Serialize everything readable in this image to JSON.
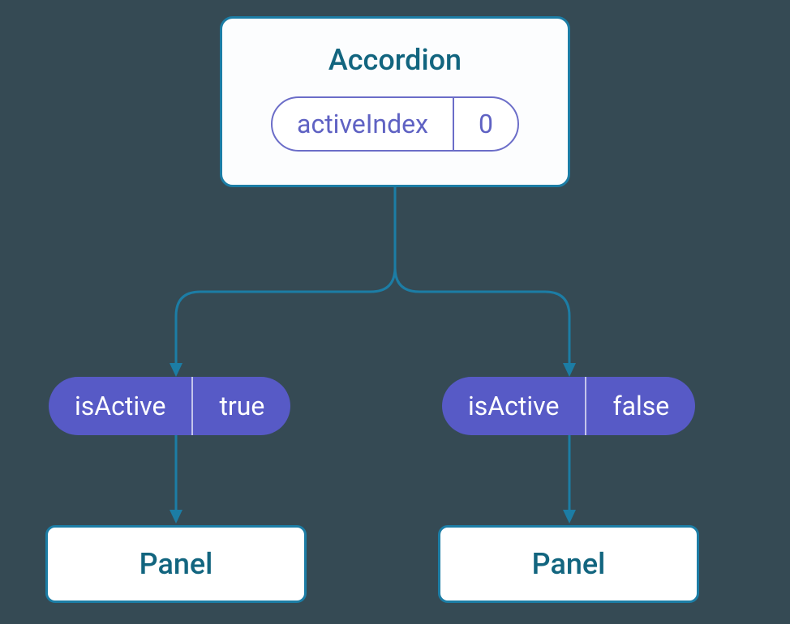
{
  "accordion": {
    "title": "Accordion",
    "state": {
      "label": "activeIndex",
      "value": "0"
    }
  },
  "props": {
    "left": {
      "label": "isActive",
      "value": "true"
    },
    "right": {
      "label": "isActive",
      "value": "false"
    }
  },
  "panels": {
    "left": {
      "title": "Panel"
    },
    "right": {
      "title": "Panel"
    }
  },
  "colors": {
    "background": "#354a54",
    "boxBorder": "#1c7da5",
    "boxText": "#12657f",
    "pillPurple": "#575ac6",
    "pillOutline": "#6b6dc8"
  }
}
